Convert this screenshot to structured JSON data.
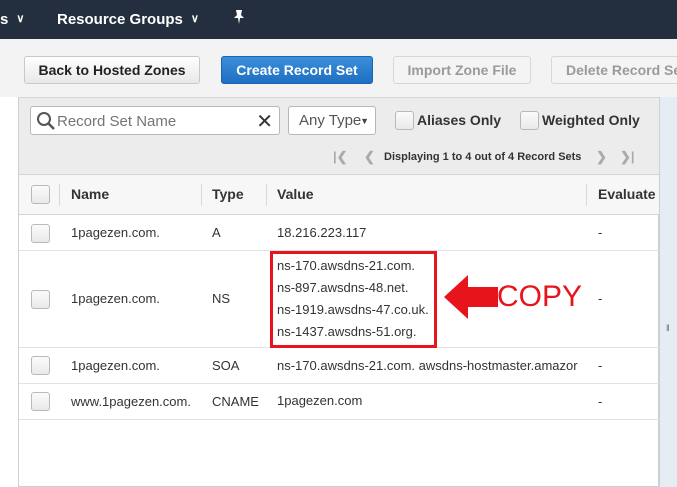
{
  "topbar": {
    "fragment": "s",
    "resource_groups": "Resource Groups"
  },
  "toolbar": {
    "back": "Back to Hosted Zones",
    "create": "Create Record Set",
    "import": "Import Zone File",
    "delete": "Delete Record Se"
  },
  "filter": {
    "search_placeholder": "Record Set Name",
    "type_select": "Any Type",
    "aliases_only": "Aliases Only",
    "weighted_only": "Weighted Only",
    "pager_text": "Displaying 1 to 4 out of 4 Record Sets"
  },
  "table": {
    "columns": [
      "Name",
      "Type",
      "Value",
      "Evaluate"
    ],
    "rows": [
      {
        "name": "1pagezen.com.",
        "type": "A",
        "values": [
          "18.216.223.117"
        ],
        "evaluate": "-"
      },
      {
        "name": "1pagezen.com.",
        "type": "NS",
        "values": [
          "ns-170.awsdns-21.com.",
          "ns-897.awsdns-48.net.",
          "ns-1919.awsdns-47.co.uk.",
          "ns-1437.awsdns-51.org."
        ],
        "evaluate": "-"
      },
      {
        "name": "1pagezen.com.",
        "type": "SOA",
        "values": [
          "ns-170.awsdns-21.com. awsdns-hostmaster.amazor"
        ],
        "evaluate": "-"
      },
      {
        "name": "www.1pagezen.com.",
        "type": "CNAME",
        "values": [
          "1pagezen.com"
        ],
        "evaluate": "-"
      }
    ]
  },
  "annotation": {
    "label": "COPY",
    "color": "#e8141c"
  }
}
